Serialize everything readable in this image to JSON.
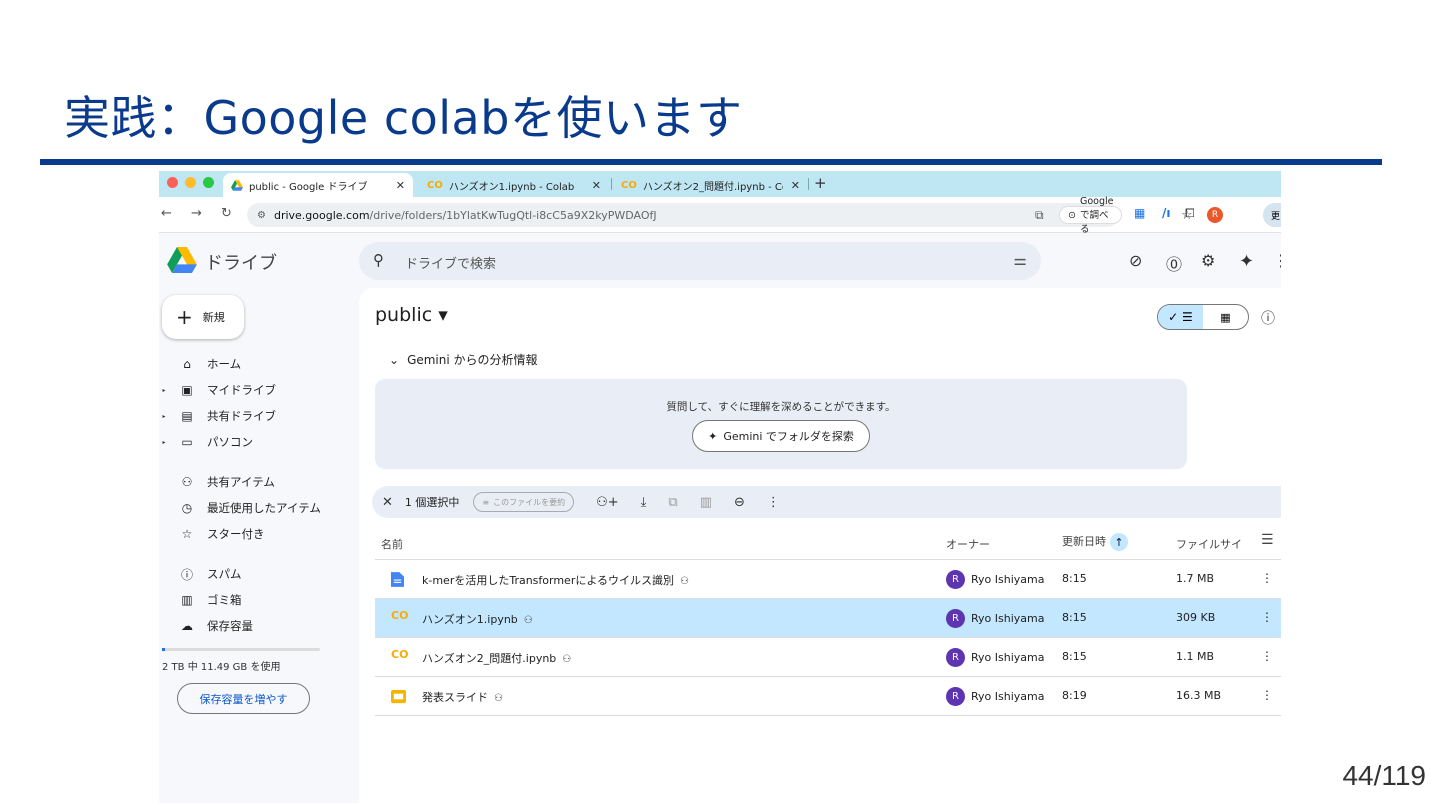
{
  "slide": {
    "title": "実践：Google colabを使います",
    "page_number": "44/119"
  },
  "browser": {
    "tabs": [
      {
        "label": "public - Google ドライブ",
        "active": true
      },
      {
        "label": "ハンズオン1.ipynb - Colab",
        "active": false
      },
      {
        "label": "ハンズオン2_問題付.ipynb - Co",
        "active": false
      }
    ],
    "new_tab": "+",
    "url_host": "drive.google.com",
    "url_path": "/drive/folders/1bYlatKwTugQtl-i8cC5a9X2kyPWDAOfJ",
    "google_search_chip": "Google で調べる",
    "profile_initial": "R",
    "edge_label": "更"
  },
  "drive": {
    "logo_text": "ドライブ",
    "search_placeholder": "ドライブで検索",
    "new_button": "新規",
    "sidebar": [
      {
        "label": "ホーム",
        "icon": "home-icon",
        "glyph": "⌂",
        "arrow": false
      },
      {
        "label": "マイドライブ",
        "icon": "my-drive-icon",
        "glyph": "▣",
        "arrow": true
      },
      {
        "label": "共有ドライブ",
        "icon": "shared-drive-icon",
        "glyph": "▤",
        "arrow": true
      },
      {
        "label": "パソコン",
        "icon": "computer-icon",
        "glyph": "▭",
        "arrow": true
      },
      {
        "label": "共有アイテム",
        "icon": "people-icon",
        "glyph": "⚇",
        "arrow": false
      },
      {
        "label": "最近使用したアイテム",
        "icon": "clock-icon",
        "glyph": "◷",
        "arrow": false
      },
      {
        "label": "スター付き",
        "icon": "star-icon",
        "glyph": "☆",
        "arrow": false
      },
      {
        "label": "スパム",
        "icon": "spam-icon",
        "glyph": "ⓘ",
        "arrow": false
      },
      {
        "label": "ゴミ箱",
        "icon": "trash-icon",
        "glyph": "▥",
        "arrow": false
      },
      {
        "label": "保存容量",
        "icon": "cloud-icon",
        "glyph": "☁",
        "arrow": false
      }
    ],
    "storage_used_fraction": 0.01,
    "storage_text": "2 TB 中 11.49 GB を使用",
    "storage_button": "保存容量を増やす",
    "folder_title": "public ▾",
    "gemini_header": "Gemini からの分析情報",
    "gemini_prompt": "質問して、すぐに理解を深めることができます。",
    "gemini_button": "Gemini でフォルダを探索",
    "selection_text": "1 個選択中",
    "summarize_button": "このファイルを要約",
    "columns": {
      "name": "名前",
      "owner": "オーナー",
      "modified": "更新日時",
      "size": "ファイルサイ"
    },
    "files": [
      {
        "name": "k-merを活用したTransformerによるウイルス識別",
        "type": "doc",
        "owner": "Ryo Ishiyama",
        "modified": "8:15",
        "size": "1.7 MB",
        "selected": false
      },
      {
        "name": "ハンズオン1.ipynb",
        "type": "colab",
        "owner": "Ryo Ishiyama",
        "modified": "8:15",
        "size": "309 KB",
        "selected": true
      },
      {
        "name": "ハンズオン2_問題付.ipynb",
        "type": "colab",
        "owner": "Ryo Ishiyama",
        "modified": "8:15",
        "size": "1.1 MB",
        "selected": false
      },
      {
        "name": "発表スライド",
        "type": "slides",
        "owner": "Ryo Ishiyama",
        "modified": "8:19",
        "size": "16.3 MB",
        "selected": false
      }
    ],
    "owner_initial": "R"
  },
  "colors": {
    "title_blue": "#0a3a8c",
    "tabbar": "#bfe6f3",
    "selected_row": "#c2e7ff",
    "owner_avatar": "#5e35b1",
    "colab_orange": "#f9ab00"
  }
}
